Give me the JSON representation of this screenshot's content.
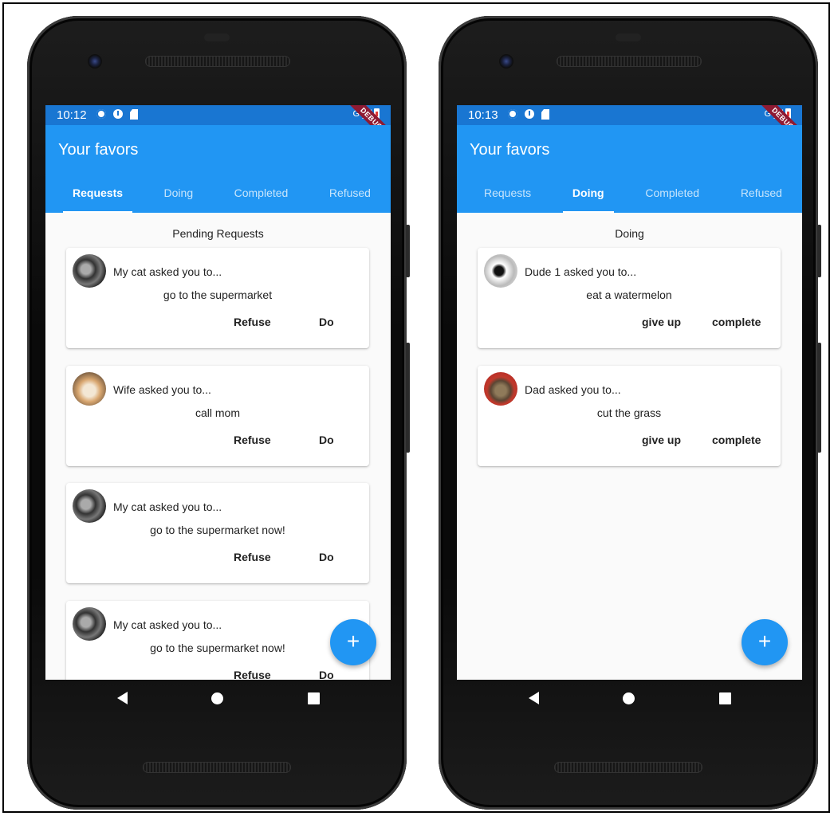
{
  "phones": [
    {
      "status": {
        "time": "10:12",
        "network": "G"
      },
      "debug_label": "DEBUG",
      "appbar": {
        "title": "Your favors"
      },
      "tabs": [
        {
          "label": "Requests",
          "active": true
        },
        {
          "label": "Doing",
          "active": false
        },
        {
          "label": "Completed",
          "active": false
        },
        {
          "label": "Refused",
          "active": false
        }
      ],
      "section_title": "Pending Requests",
      "cards": [
        {
          "avatar": "cat-bw-avatar",
          "asker": "My cat asked you to...",
          "favor": "go to the supermarket",
          "actions": [
            "Refuse",
            "Do"
          ]
        },
        {
          "avatar": "cat-orange-avatar",
          "asker": "Wife asked you to...",
          "favor": "call mom",
          "actions": [
            "Refuse",
            "Do"
          ]
        },
        {
          "avatar": "cat-bw-avatar",
          "asker": "My cat asked you to...",
          "favor": "go to the supermarket now!",
          "actions": [
            "Refuse",
            "Do"
          ]
        },
        {
          "avatar": "cat-bw-avatar",
          "asker": "My cat asked you to...",
          "favor": "go to the supermarket now!",
          "actions": [
            "Refuse",
            "Do"
          ]
        }
      ],
      "fab_icon": "+"
    },
    {
      "status": {
        "time": "10:13",
        "network": "G"
      },
      "debug_label": "DEBUG",
      "appbar": {
        "title": "Your favors"
      },
      "tabs": [
        {
          "label": "Requests",
          "active": false
        },
        {
          "label": "Doing",
          "active": true
        },
        {
          "label": "Completed",
          "active": false
        },
        {
          "label": "Refused",
          "active": false
        }
      ],
      "section_title": "Doing",
      "cards": [
        {
          "avatar": "dude-avatar",
          "asker": "Dude 1 asked you to...",
          "favor": "eat a watermelon",
          "actions": [
            "give up",
            "complete"
          ]
        },
        {
          "avatar": "dad-avatar",
          "asker": "Dad asked you to...",
          "favor": "cut the grass",
          "actions": [
            "give up",
            "complete"
          ]
        }
      ],
      "fab_icon": "+"
    }
  ],
  "colors": {
    "primary": "#2196f3",
    "status_bar": "#1976d2",
    "debug_ribbon": "#8e1a33"
  }
}
